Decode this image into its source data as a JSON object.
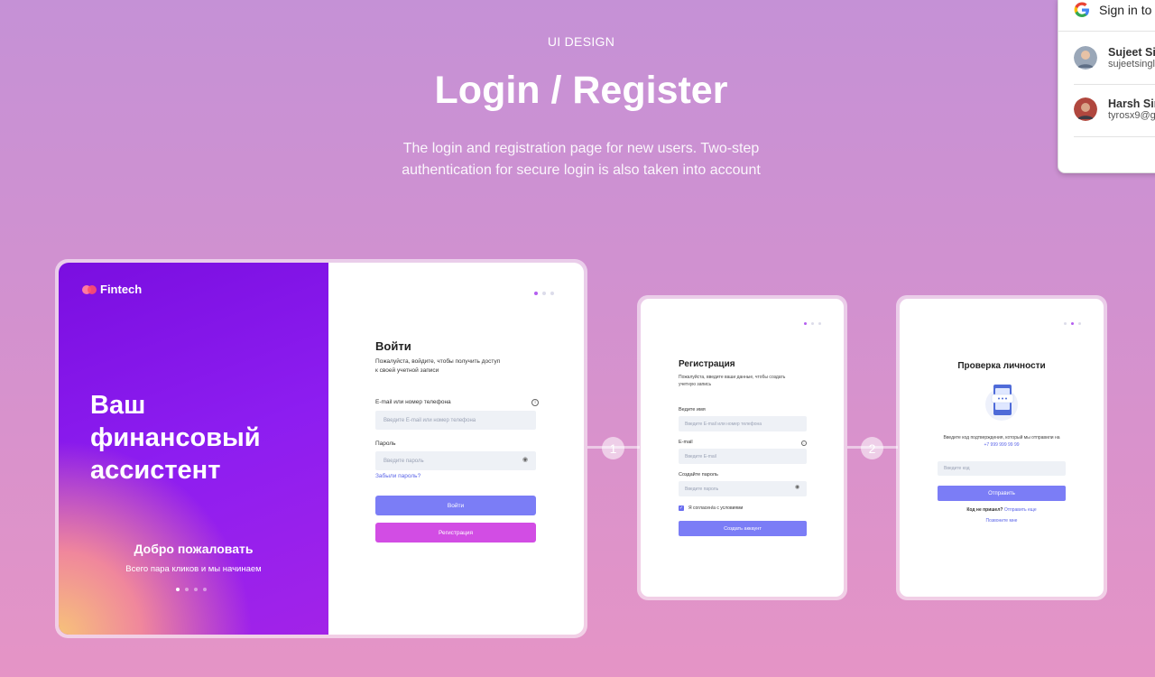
{
  "header": {
    "eyebrow": "UI DESIGN",
    "title": "Login / Register",
    "subtitle": "The login and registration page for new users. Two-step authentication for secure login is also taken into account"
  },
  "hero": {
    "brand": "Fintech",
    "headline_lines": [
      "Ваш",
      "финансовый",
      "ассистент"
    ],
    "welcome": "Добро пожаловать",
    "tagline": "Всего пара кликов и мы начинаем",
    "active_dot": 1,
    "dot_count": 4
  },
  "login": {
    "title": "Войти",
    "subtitle": "Пожалуйста, войдите, чтобы получить доступ к своей учетной записи",
    "email_label": "E-mail или номер телефона",
    "email_placeholder": "Введите E-mail или номер телефона",
    "password_label": "Пароль",
    "password_placeholder": "Введите пароль",
    "forgot_link": "Забыли пароль?",
    "login_button": "Войти",
    "register_button": "Регистрация"
  },
  "steps": [
    "1",
    "2"
  ],
  "register": {
    "title": "Регистрация",
    "subtitle": "Пожалуйста, введите ваши данные, чтобы создать учетную запись",
    "name_label": "Ведите имя",
    "name_placeholder": "Введите E-mail или номер телефона",
    "email_label": "E-mail",
    "email_placeholder": "Введите E-mail",
    "password_label": "Создайте пароль",
    "password_placeholder": "Введите пароль",
    "agree_text": "Я согласен/а с условиями",
    "create_button": "Создать аккаунт"
  },
  "verify": {
    "title": "Проверка личности",
    "info": "Введите код подтверждения, который мы отправили на",
    "phone": "+7 999 999 99 99",
    "code_placeholder": "Введите код",
    "send_button": "Отправить",
    "not_received": "Код не пришел?",
    "resend_link": "Отправить еще",
    "call_link": "Позвоните мне"
  },
  "google_chooser": {
    "title": "Sign in to",
    "accounts": [
      {
        "name": "Sujeet Si",
        "email": "sujeetsingl"
      },
      {
        "name": "Harsh Sir",
        "email": "tyrosx9@g"
      }
    ]
  },
  "colors": {
    "accent_blue": "#7b7df6",
    "accent_pink": "#d24de4",
    "hero_purple": "#8d1df0"
  }
}
